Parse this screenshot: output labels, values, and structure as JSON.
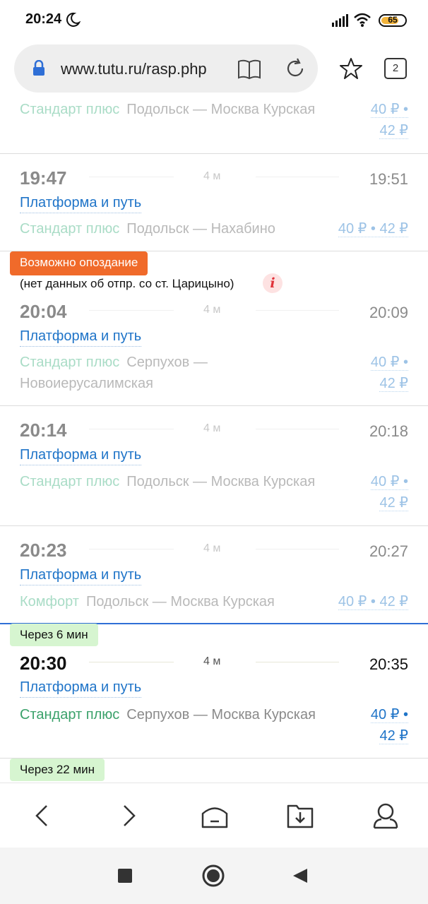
{
  "status": {
    "time": "20:24",
    "battery": "65"
  },
  "browser": {
    "url": "www.tutu.ru/rasp.php",
    "tab_count": "2"
  },
  "top_partial": {
    "class": "Стандарт плюс",
    "route": "Подольск — Москва Курская",
    "price_1": "40 ₽ •",
    "price_2": "42 ₽"
  },
  "trains": [
    {
      "dep": "19:47",
      "dur": "4 м",
      "arr": "19:51",
      "platform": "Платформа и путь",
      "class": "Стандарт плюс",
      "route": "Подольск — Нахабино",
      "price_1": "40 ₽ • 42 ₽",
      "price_2": ""
    },
    {
      "dep": "20:04",
      "dur": "4 м",
      "arr": "20:09",
      "platform": "Платформа и путь",
      "class": "Стандарт плюс",
      "route": "Серпухов — Новоиерусалимская",
      "price_1": "40 ₽ •",
      "price_2": "42 ₽"
    },
    {
      "dep": "20:14",
      "dur": "4 м",
      "arr": "20:18",
      "platform": "Платформа и путь",
      "class": "Стандарт плюс",
      "route": "Подольск — Москва Курская",
      "price_1": "40 ₽ •",
      "price_2": "42 ₽"
    },
    {
      "dep": "20:23",
      "dur": "4 м",
      "arr": "20:27",
      "platform": "Платформа и путь",
      "class": "Комфорт",
      "route": "Подольск — Москва Курская",
      "price_1": "40 ₽ • 42 ₽",
      "price_2": ""
    },
    {
      "dep": "20:30",
      "dur": "4 м",
      "arr": "20:35",
      "platform": "Платформа и путь",
      "class": "Стандарт плюс",
      "route": "Серпухов — Москва Курская",
      "price_1": "40 ₽ •",
      "price_2": "42 ₽"
    }
  ],
  "delay": {
    "badge": "Возможно опоздание",
    "note": "(нет данных об отпр. со ст. Царицыно)",
    "icon_text": "i"
  },
  "eta_badges": [
    "Через 6 мин",
    "Через 22 мин"
  ],
  "colors": {
    "accent": "#1f74c8",
    "delay": "#f06a2a",
    "eta": "#d6f5d0",
    "class_green": "#3aa16a"
  },
  "icons": [
    "moon-icon",
    "signal-icon",
    "wifi-icon",
    "lock-icon",
    "reader-icon",
    "reload-icon",
    "star-icon",
    "back-icon",
    "forward-icon",
    "home-icon",
    "downloads-icon",
    "profile-icon"
  ]
}
